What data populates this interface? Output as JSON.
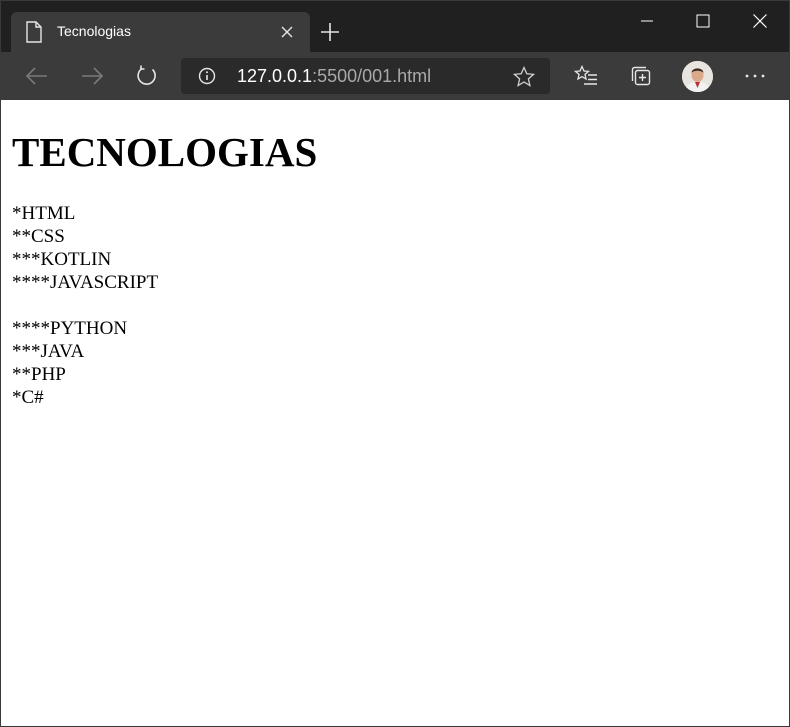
{
  "browser": {
    "tab": {
      "title": "Tecnologias",
      "icon": "document-icon"
    },
    "address": {
      "host": "127.0.0.1",
      "rest": ":5500/001.html",
      "info_icon": "info-icon"
    },
    "toolbar_icons": [
      "back-arrow-icon",
      "forward-arrow-icon",
      "refresh-icon",
      "favorite-star-icon",
      "favorites-list-icon",
      "collections-icon",
      "avatar",
      "more-icon"
    ],
    "colors": {
      "frame": "#202020",
      "toolbar": "#3b3b3b",
      "address_bg": "#2a2a2a",
      "url_muted": "#a9a9a9"
    }
  },
  "page": {
    "heading": "TECNOLOGIAS",
    "list_one": [
      "*HTML",
      "**CSS",
      "***KOTLIN",
      "****JAVASCRIPT"
    ],
    "list_two": [
      "****PYTHON",
      "***JAVA",
      "**PHP",
      "*C#"
    ]
  }
}
